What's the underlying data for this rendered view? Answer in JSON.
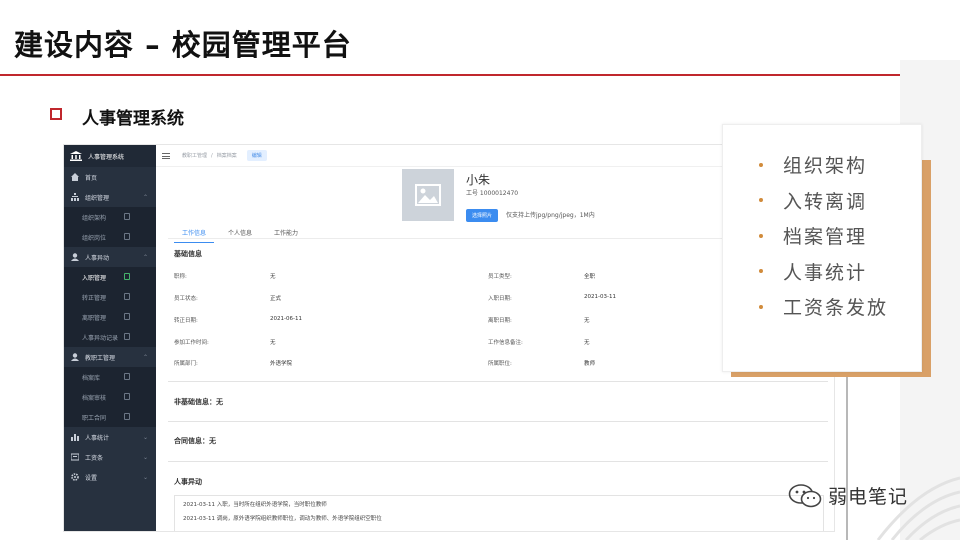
{
  "slide": {
    "title": "建设内容 – 校园管理平台",
    "section": "人事管理系统"
  },
  "colors": {
    "accent_red": "#c0272d",
    "accent_orange": "#d18b3b",
    "sidebar_bg": "#27313f",
    "primary_blue": "#3b8cf0"
  },
  "sidebar": {
    "brand": "人事管理系统",
    "items": [
      {
        "label": "首页",
        "kind": "group",
        "icon": "home-icon"
      },
      {
        "label": "组织管理",
        "kind": "group",
        "icon": "org-icon",
        "chevron": "⌃"
      },
      {
        "label": "组织架构",
        "kind": "sub",
        "lock": true
      },
      {
        "label": "组织岗位",
        "kind": "sub",
        "lock": true
      },
      {
        "label": "人事异动",
        "kind": "group",
        "icon": "user-icon",
        "chevron": "⌃"
      },
      {
        "label": "入职管理",
        "kind": "sub",
        "lock": true,
        "active": true
      },
      {
        "label": "转正管理",
        "kind": "sub",
        "lock": true
      },
      {
        "label": "离职管理",
        "kind": "sub",
        "lock": true
      },
      {
        "label": "人事异动记录",
        "kind": "sub",
        "lock": true
      },
      {
        "label": "教职工管理",
        "kind": "group",
        "icon": "user-icon",
        "chevron": "⌃"
      },
      {
        "label": "档案库",
        "kind": "sub",
        "lock": true
      },
      {
        "label": "档案审核",
        "kind": "sub",
        "lock": true
      },
      {
        "label": "职工合同",
        "kind": "sub",
        "lock": true
      },
      {
        "label": "人事统计",
        "kind": "group",
        "icon": "chart-icon",
        "chevron": "⌄"
      },
      {
        "label": "工资条",
        "kind": "group",
        "icon": "payslip-icon",
        "chevron": "⌄"
      },
      {
        "label": "设置",
        "kind": "group",
        "icon": "gear-icon",
        "chevron": "⌄"
      }
    ]
  },
  "topbar": {
    "crumb1": "教职工管理",
    "separator": "/",
    "crumb2": "档案档案",
    "chip": "编辑"
  },
  "profile": {
    "name": "小朱",
    "employee_id": "工号 1000012470",
    "upload_button": "选择照片",
    "upload_hint": "仅支持上传jpg/png/jpeg，1M内"
  },
  "tabs": [
    "工作信息",
    "个人信息",
    "工作能力"
  ],
  "basic_info": {
    "heading": "基础信息",
    "rows": [
      {
        "l1": "职称:",
        "v1": "无",
        "l2": "员工类型:",
        "v2": "全职"
      },
      {
        "l1": "员工状态:",
        "v1": "正式",
        "l2": "入职日期:",
        "v2": "2021-03-11"
      },
      {
        "l1": "转正日期:",
        "v1": "2021-06-11",
        "l2": "离职日期:",
        "v2": "无"
      },
      {
        "l1": "参加工作时间:",
        "v1": "无",
        "l2": "工作信息备注:",
        "v2": "无"
      },
      {
        "l1": "所属部门:",
        "v1": "外语学院",
        "l2": "所属职位:",
        "v2": "教师"
      }
    ]
  },
  "non_basic": "非基础信息：无",
  "contract": "合同信息：无",
  "changes": {
    "heading": "人事异动",
    "lines": [
      "2021-03-11 入职，当时所在组织外语学院，当时职位教师",
      "2021-03-11 调岗，原外语学院组织教师职位，调动为教师、外语学院组织空职位"
    ]
  },
  "callout": {
    "items": [
      "组织架构",
      "入转离调",
      "档案管理",
      "人事统计",
      "工资条发放"
    ]
  },
  "watermark": {
    "text": "弱电笔记",
    "icon": "wechat-icon"
  }
}
